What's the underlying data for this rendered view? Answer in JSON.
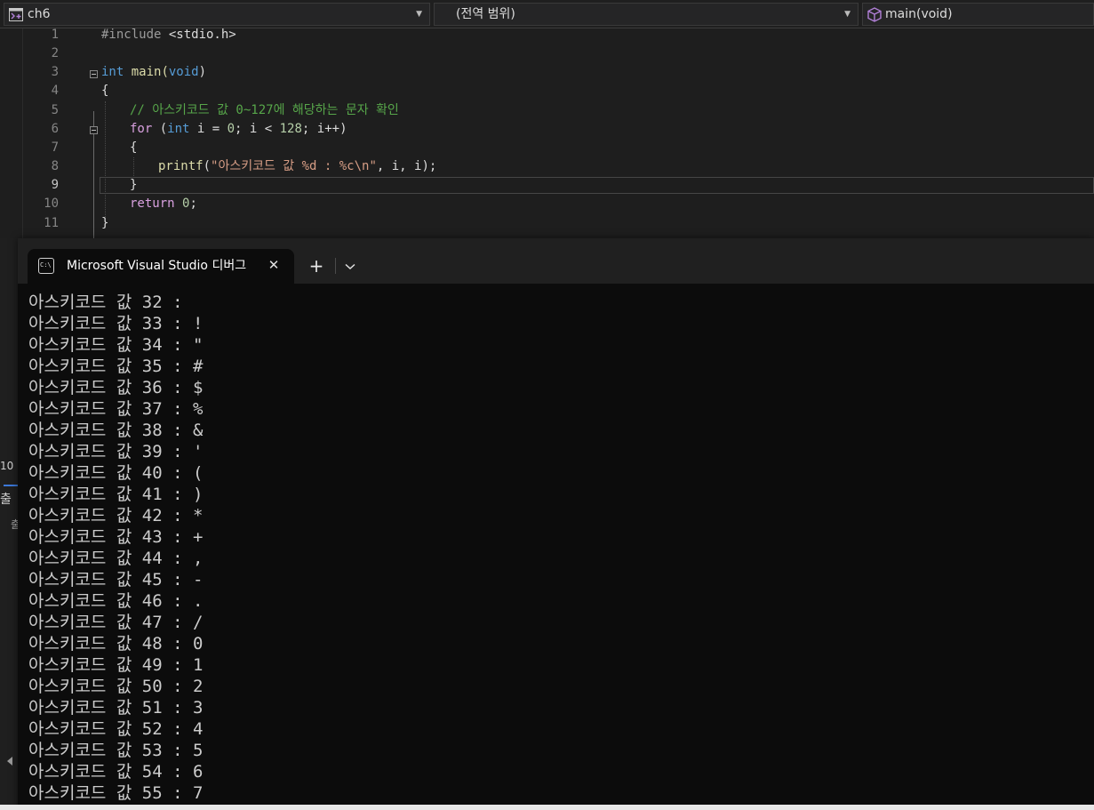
{
  "navbar": {
    "project": "ch6",
    "scope": "(전역 범위)",
    "member": "main(void)"
  },
  "editor": {
    "line_numbers": [
      "1",
      "2",
      "3",
      "4",
      "5",
      "6",
      "7",
      "8",
      "9",
      "10",
      "11"
    ],
    "active_line": "9",
    "code": {
      "l1_include": "#include ",
      "l1_header": "<stdio.h>",
      "l3_int": "int",
      "l3_main": " main(",
      "l3_void": "void",
      "l3_close": ")",
      "l4": "{",
      "l5_comment": "// 아스키코드 값 0~127에 해당하는 문자 확인",
      "l6_for": "for",
      "l6_open": " (",
      "l6_int": "int",
      "l6_mid1": " i = ",
      "l6_zero": "0",
      "l6_mid2": "; i < ",
      "l6_num": "128",
      "l6_end": "; i++)",
      "l7": "{",
      "l8_printf": "printf",
      "l8_open": "(",
      "l8_string": "\"아스키코드 값 %d : %c\\n\"",
      "l8_end": ", i, i);",
      "l9": "}",
      "l10_return": "return",
      "l10_space": " ",
      "l10_zero": "0",
      "l10_semi": ";",
      "l11": "}"
    }
  },
  "left_remnants": {
    "a": "10",
    "b": "출",
    "c": "출"
  },
  "terminal": {
    "tab_title": "Microsoft Visual Studio 디버그",
    "tab_icon_text": "C:\\",
    "close_glyph": "✕",
    "new_tab_glyph": "+",
    "output": [
      "아스키코드 값 32 :  ",
      "아스키코드 값 33 : !",
      "아스키코드 값 34 : \"",
      "아스키코드 값 35 : #",
      "아스키코드 값 36 : $",
      "아스키코드 값 37 : %",
      "아스키코드 값 38 : &",
      "아스키코드 값 39 : '",
      "아스키코드 값 40 : (",
      "아스키코드 값 41 : )",
      "아스키코드 값 42 : *",
      "아스키코드 값 43 : +",
      "아스키코드 값 44 : ,",
      "아스키코드 값 45 : -",
      "아스키코드 값 46 : .",
      "아스키코드 값 47 : /",
      "아스키코드 값 48 : 0",
      "아스키코드 값 49 : 1",
      "아스키코드 값 50 : 2",
      "아스키코드 값 51 : 3",
      "아스키코드 값 52 : 4",
      "아스키코드 값 53 : 5",
      "아스키코드 값 54 : 6",
      "아스키코드 값 55 : 7"
    ]
  },
  "colors": {
    "keyword": "#569cd6",
    "control_keyword": "#d8a0df",
    "function": "#dcdcaa",
    "string": "#d69d85",
    "comment": "#57a64a",
    "terminal_bg": "#0c0c0c"
  }
}
